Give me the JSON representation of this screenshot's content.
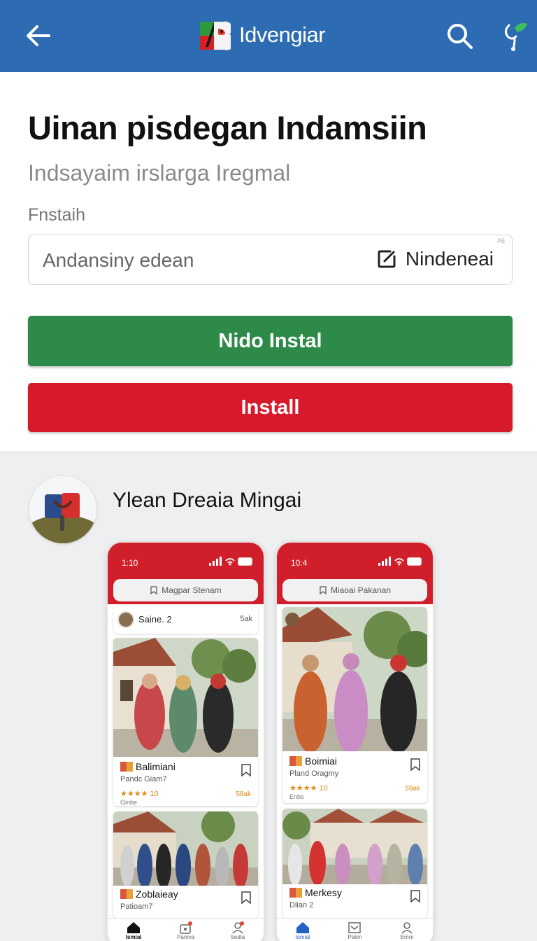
{
  "header": {
    "back_icon": "arrow-left-icon",
    "brand_name": "Idvengiar",
    "search_icon": "search-icon",
    "action_icon": "leaf-flag-icon",
    "bg_color": "#2d6bb3"
  },
  "main": {
    "title": "Uinan pisdegan Indamsiin",
    "subtitle": "Indsayaim irslarga Iregmal",
    "field_label": "Fnstaih",
    "input_value": "Andansiny edean",
    "input_action_label": "Nindeneai",
    "input_corner": "A5",
    "primary_button": "Nido Instal",
    "primary_color": "#2e8a49",
    "install_button": "Install",
    "install_color": "#d71a2b"
  },
  "gallery": {
    "title": "Ylean Dreaia Mingai",
    "screens": [
      {
        "time": "1:10",
        "search": "Magpar Stenam",
        "user_name": "Saine. 2",
        "user_count": "5ak",
        "card1_name": "Balimiani",
        "card1_sub": "Pandc Giam7",
        "card1_rating": "★★★★ 10",
        "card1_price": "58ak",
        "card1_extra": "Ginbe",
        "card2_name": "Zoblaieay",
        "card2_sub": "Patioam7",
        "nav": [
          "Ismial",
          "Pamva",
          "Sedia"
        ]
      },
      {
        "time": "10:4",
        "search": "Miaoai Pakanan",
        "card1_name": "Boimiai",
        "card1_sub": "Pland Oragmy",
        "card1_rating": "★★★★ 10",
        "card1_price": "59ak",
        "card1_extra": "Enbs",
        "card2_name": "Merkesy",
        "card2_sub": "Dlian 2",
        "nav": [
          "Ismial",
          "Pakin",
          "Emni"
        ]
      }
    ]
  }
}
